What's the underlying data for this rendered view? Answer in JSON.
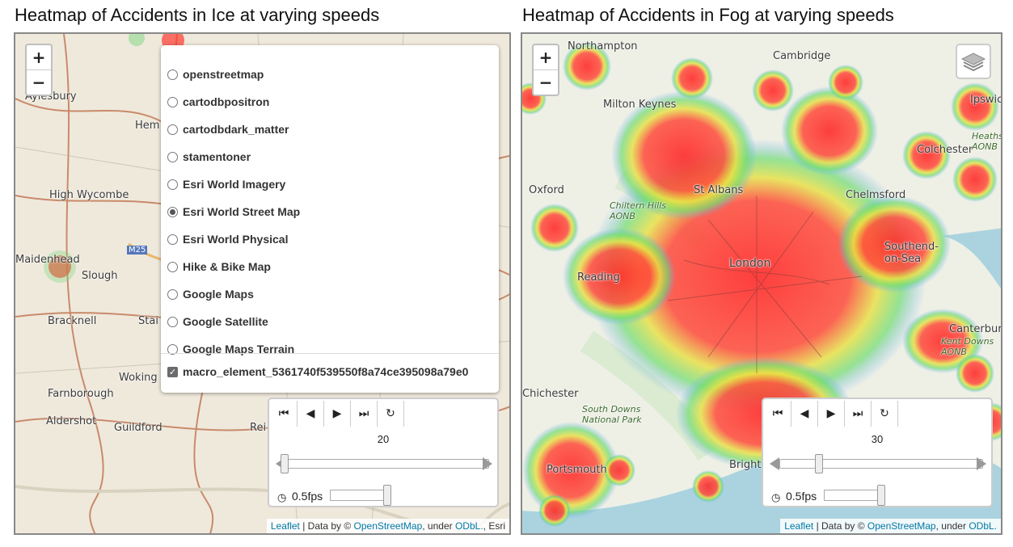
{
  "left_map": {
    "title": "Heatmap of Accidents in Ice at varying speeds",
    "zoom_in": "+",
    "zoom_out": "−",
    "layers": [
      {
        "label": "openstreetmap",
        "selected": false
      },
      {
        "label": "cartodbpositron",
        "selected": false
      },
      {
        "label": "cartodbdark_matter",
        "selected": false
      },
      {
        "label": "stamentoner",
        "selected": false
      },
      {
        "label": "Esri World Imagery",
        "selected": false
      },
      {
        "label": "Esri World Street Map",
        "selected": true
      },
      {
        "label": "Esri World Physical",
        "selected": false
      },
      {
        "label": "Hike & Bike Map",
        "selected": false
      },
      {
        "label": "Google Maps",
        "selected": false
      },
      {
        "label": "Google Satellite",
        "selected": false
      },
      {
        "label": "Google Maps Terrain",
        "selected": false
      }
    ],
    "overlay": {
      "label": "macro_element_5361740f539550f8a74ce395098a79e0",
      "checked": true
    },
    "player": {
      "frame_value": "20",
      "fps": "0.5fps",
      "slider_fraction": 0.0
    },
    "places": [
      "Aylesbury",
      "High Wycombe",
      "Maidenhead",
      "Slough",
      "Bracknell",
      "Woking",
      "Farnborough",
      "Aldershot",
      "Guildford",
      "M25",
      "Hem",
      "Stai",
      "Rei"
    ],
    "attribution": {
      "leaflet": "Leaflet",
      "data_by": " | Data by © ",
      "osm": "OpenStreetMap",
      "under": ", under ",
      "odbl": "ODbL.",
      "suffix": ", Esri"
    }
  },
  "right_map": {
    "title": "Heatmap of Accidents in Fog at varying speeds",
    "zoom_in": "+",
    "zoom_out": "−",
    "player": {
      "frame_value": "30",
      "fps": "0.5fps",
      "slider_fraction": 0.2
    },
    "places": [
      "Northampton",
      "Cambridge",
      "Milton Keynes",
      "Ipswich",
      "Colchester",
      "Oxford",
      "St Albans",
      "Chelmsford",
      "Chiltern Hills AONB",
      "Southend-on-Sea",
      "London",
      "Reading",
      "Canterbury",
      "Kent Downs AONB",
      "South Downs National Park",
      "Chichester",
      "Portsmouth",
      "Brighton",
      "Heaths AONB"
    ],
    "attribution": {
      "leaflet": "Leaflet",
      "data_by": " | Data by © ",
      "osm": "OpenStreetMap",
      "under": ", under ",
      "odbl": "ODbL."
    }
  },
  "player_buttons": [
    "⏮",
    "◀",
    "▶",
    "⏭",
    "↻"
  ],
  "fps_icon": "◷",
  "icons": [
    "layers-icon",
    "first-frame-icon",
    "prev-icon",
    "play-icon",
    "last-frame-icon",
    "loop-icon",
    "speedometer-icon"
  ]
}
